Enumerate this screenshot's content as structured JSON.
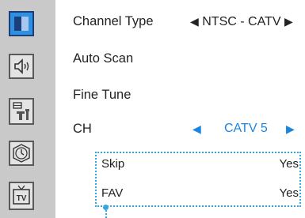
{
  "sidebar": {
    "icons": [
      {
        "name": "picture-icon",
        "active": true
      },
      {
        "name": "sound-icon",
        "active": false
      },
      {
        "name": "setup-tools-icon",
        "active": false
      },
      {
        "name": "clock-icon",
        "active": false
      },
      {
        "name": "tv-icon",
        "active": false,
        "text": "TV"
      }
    ]
  },
  "menu": {
    "channel_type_label": "Channel Type",
    "channel_type_value": "NTSC - CATV",
    "auto_scan_label": "Auto Scan",
    "fine_tune_label": "Fine Tune",
    "ch_label": "CH",
    "ch_value": "CATV 5"
  },
  "submenu": {
    "skip_label": "Skip",
    "skip_value": "Yes",
    "fav_label": "FAV",
    "fav_value": "Yes"
  },
  "colors": {
    "highlight": "#1a86e0",
    "dotted_border": "#34a7df",
    "sidebar_bg": "#c9c9c9"
  }
}
